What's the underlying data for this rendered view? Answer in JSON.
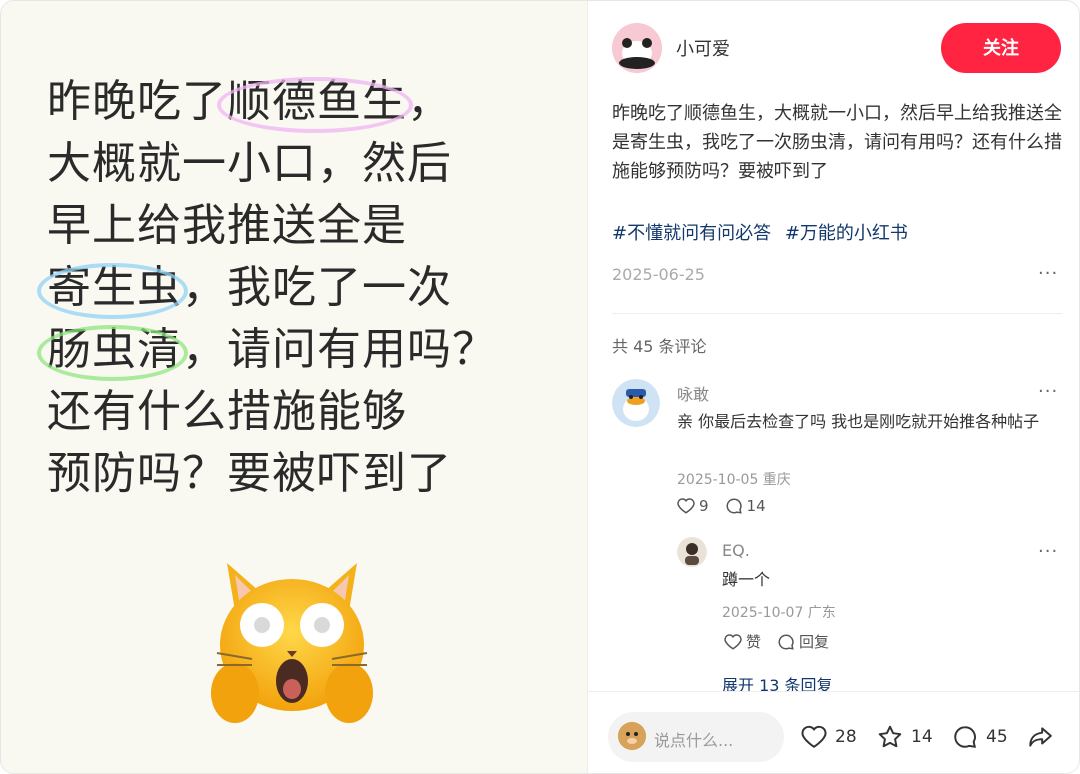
{
  "post_image": {
    "lines": [
      [
        "昨晚吃了",
        "顺德鱼生",
        "，"
      ],
      [
        "大概就一小口，然后"
      ],
      [
        "早上给我推送全是"
      ],
      [
        "",
        "寄生虫",
        "，我吃了一次"
      ],
      [
        "",
        "肠虫清",
        "，请问有用吗？"
      ],
      [
        "还有什么措施能够"
      ],
      [
        "预防吗？要被吓到了"
      ]
    ]
  },
  "author": {
    "name": "小可爱",
    "follow_label": "关注"
  },
  "post": {
    "body": "昨晚吃了顺德鱼生，大概就一小口，然后早上给我推送全是寄生虫，我吃了一次肠虫清，请问有用吗？还有什么措施能够预防吗？要被吓到了",
    "tags": [
      "#不懂就问有问必答",
      "#万能的小红书"
    ],
    "date": "2025-06-25"
  },
  "comments": {
    "count_label": "共 45 条评论",
    "items": [
      {
        "name": "咏敢",
        "text": "亲 你最后去检查了吗 我也是刚吃就开始推各种帖子",
        "meta": "2025-10-05 重庆",
        "likes": "9",
        "replies": "14"
      }
    ],
    "reply": {
      "name": "EQ.",
      "text": "蹲一个",
      "meta": "2025-10-07 广东",
      "like_label": "赞",
      "reply_label": "回复"
    },
    "expand_label": "展开 13 条回复"
  },
  "bottom_bar": {
    "placeholder": "说点什么...",
    "likes": "28",
    "stars": "14",
    "comments": "45"
  },
  "colors": {
    "accent": "#ff2442",
    "tag": "#13386c"
  },
  "icons": [
    "heart-icon",
    "star-icon",
    "comment-icon",
    "share-icon",
    "more-icon"
  ]
}
